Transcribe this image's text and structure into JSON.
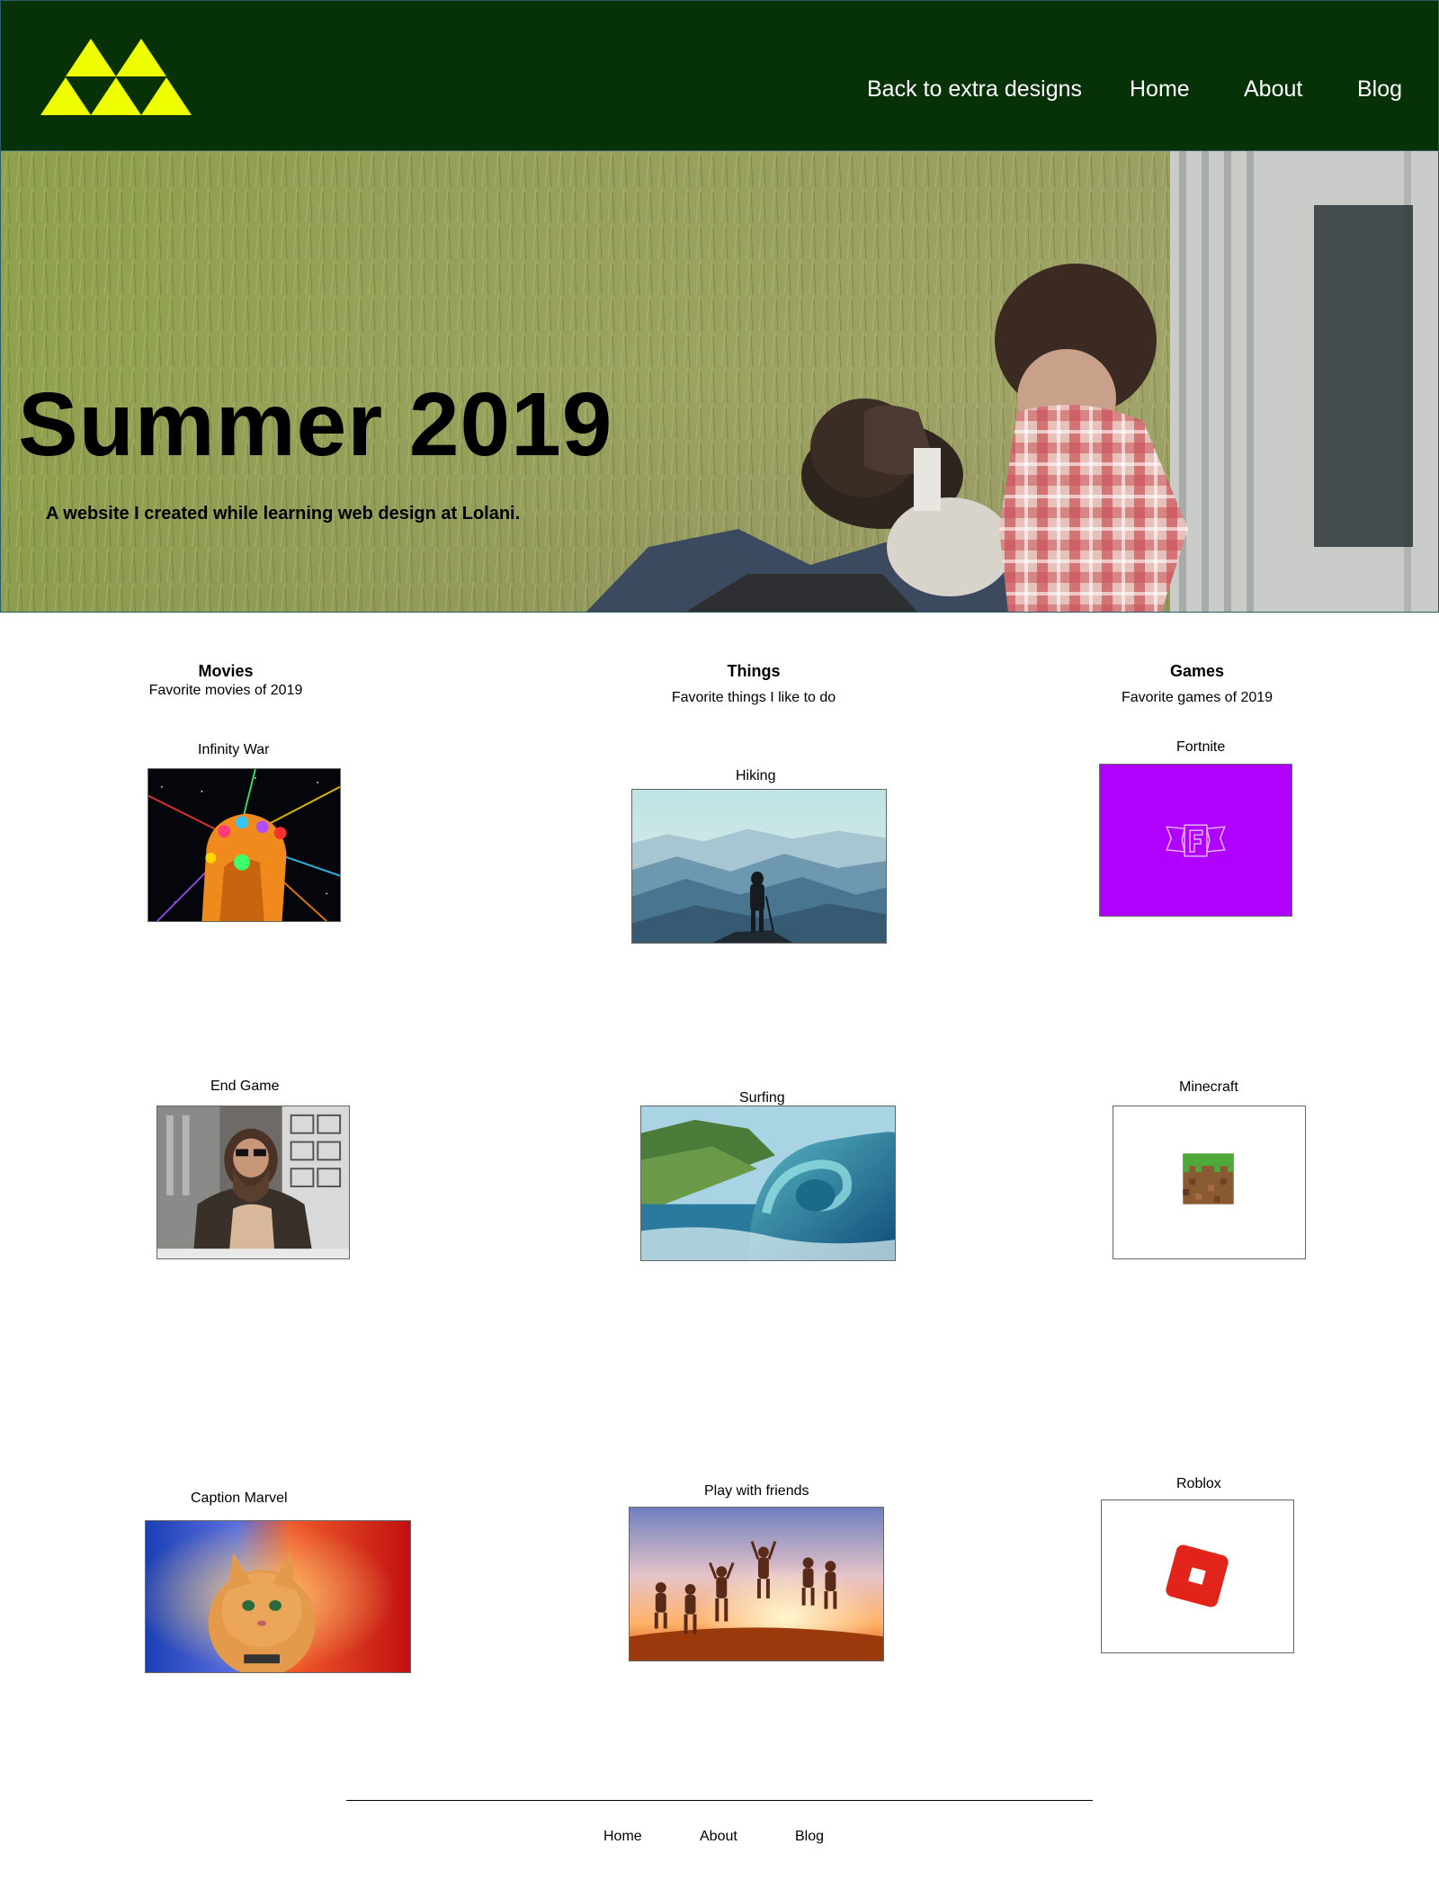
{
  "header": {
    "logo_icon": "triforce-icon",
    "nav": [
      {
        "label": "Back to extra designs"
      },
      {
        "label": "Home"
      },
      {
        "label": "About"
      },
      {
        "label": "Blog"
      }
    ],
    "colors": {
      "background": "#073208",
      "logo": "#f0ff00"
    }
  },
  "hero": {
    "title": "Summer 2019",
    "subtitle": "A website I created while learning web design at Lolani."
  },
  "columns": [
    {
      "heading": "Movies",
      "subheading": "Favorite movies of 2019",
      "items": [
        {
          "label": "Infinity War",
          "image": "infinity-gauntlet-image"
        },
        {
          "label": "End Game",
          "image": "thor-image"
        },
        {
          "label": "Caption Marvel",
          "image": "goose-cat-image"
        }
      ]
    },
    {
      "heading": "Things",
      "subheading": "Favorite things I like to do",
      "items": [
        {
          "label": "Hiking",
          "image": "hiker-mountains-image"
        },
        {
          "label": "Surfing",
          "image": "wave-image"
        },
        {
          "label": "Play with friends",
          "image": "friends-jumping-image"
        }
      ]
    },
    {
      "heading": "Games",
      "subheading": "Favorite games of 2019",
      "items": [
        {
          "label": "Fortnite",
          "image": "fortnite-logo-image"
        },
        {
          "label": "Minecraft",
          "image": "minecraft-block-image"
        },
        {
          "label": "Roblox",
          "image": "roblox-logo-image"
        }
      ]
    }
  ],
  "footer": {
    "links": [
      {
        "label": "Home"
      },
      {
        "label": "About"
      },
      {
        "label": "Blog"
      }
    ]
  }
}
